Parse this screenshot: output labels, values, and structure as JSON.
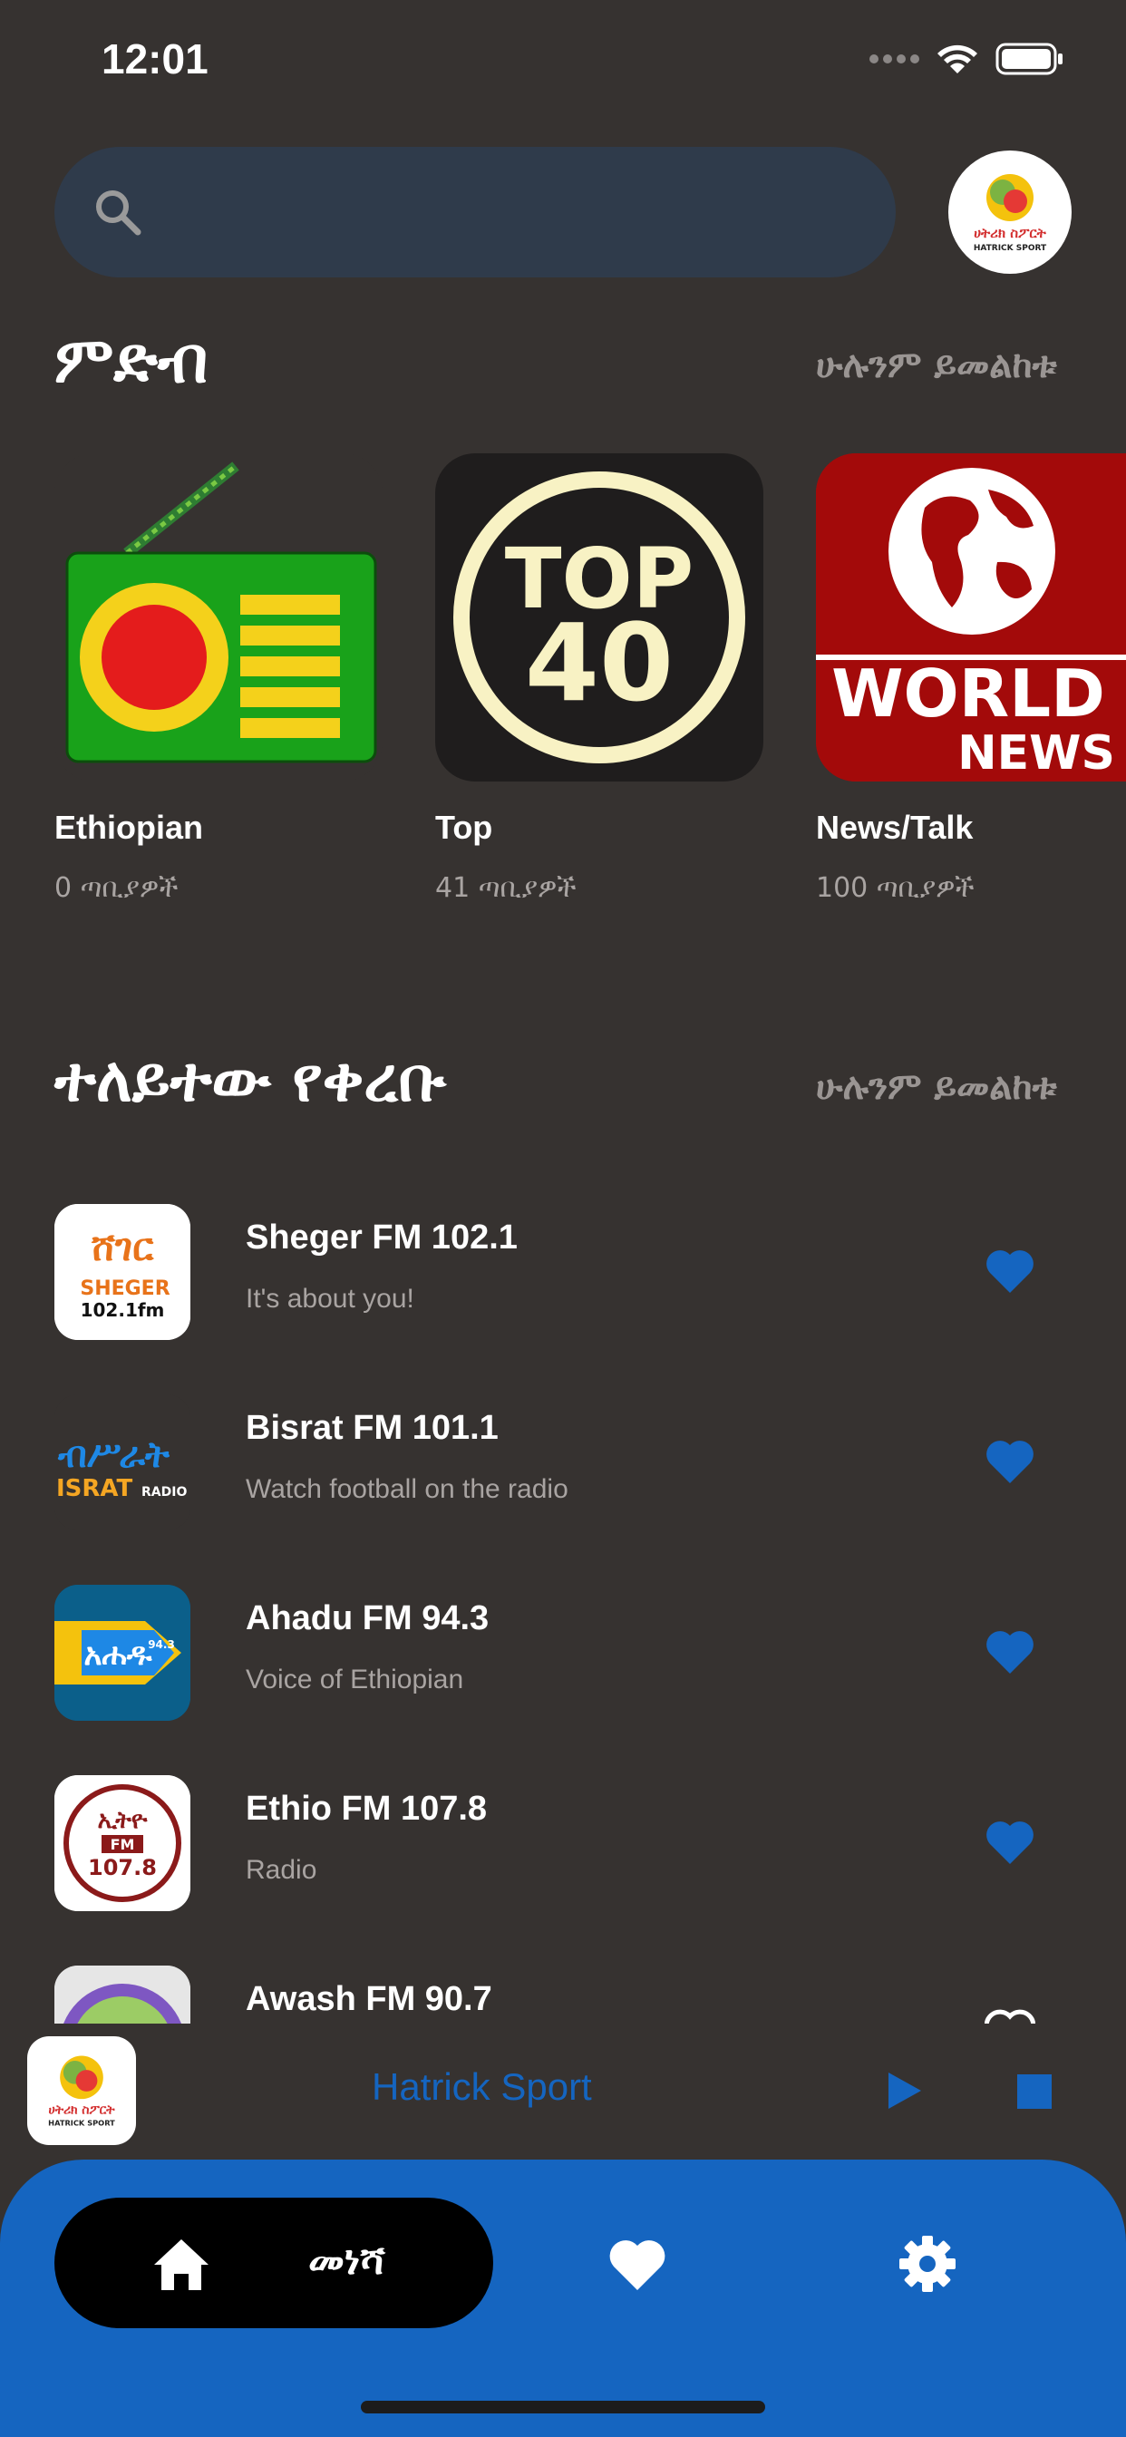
{
  "status_bar": {
    "time": "12:01"
  },
  "search": {
    "placeholder": ""
  },
  "profile": {
    "logo_name": "hatrick-sport-logo",
    "logo_text_amharic": "ሀትሪክ ስፖርት",
    "logo_text": "HATRICK SPORT"
  },
  "categories_section": {
    "title": "ምድብ",
    "see_all": "ሁሉንም ይመልከቱ",
    "items": [
      {
        "name": "Ethiopian",
        "count": "0 ጣቢያዎች",
        "icon": "ethiopian-radio-icon"
      },
      {
        "name": "Top",
        "count": "41 ጣቢያዎች",
        "icon": "top40-icon",
        "icon_text_top": "TOP",
        "icon_text_bottom": "40"
      },
      {
        "name": "News/Talk",
        "count": "100 ጣቢያዎች",
        "icon": "world-news-icon",
        "icon_text_top": "WORLD",
        "icon_text_bottom": "NEWS"
      }
    ]
  },
  "stations_section": {
    "title": "ተለይተው የቀረቡ",
    "see_all": "ሁሉንም ይመልከቱ",
    "items": [
      {
        "name": "Sheger FM 102.1",
        "subtitle": "It's about you!",
        "logo": "sheger-fm-logo",
        "favorited": true
      },
      {
        "name": "Bisrat FM 101.1",
        "subtitle": "Watch football on the radio",
        "logo": "bisrat-fm-logo",
        "favorited": true
      },
      {
        "name": "Ahadu FM 94.3",
        "subtitle": "Voice of Ethiopian",
        "logo": "ahadu-fm-logo",
        "favorited": true
      },
      {
        "name": "Ethio FM 107.8",
        "subtitle": "Radio",
        "logo": "ethio-fm-logo",
        "favorited": true
      },
      {
        "name": "Awash FM 90.7",
        "subtitle": "",
        "logo": "awash-fm-logo",
        "favorited": false
      }
    ]
  },
  "mini_player": {
    "title": "Hatrick Sport"
  },
  "bottom_nav": {
    "home_label": "መነሻ"
  },
  "colors": {
    "background": "#363230",
    "accent": "#1565c0",
    "search_bg": "#2f3b4b",
    "muted_text": "#a9a4a2"
  }
}
